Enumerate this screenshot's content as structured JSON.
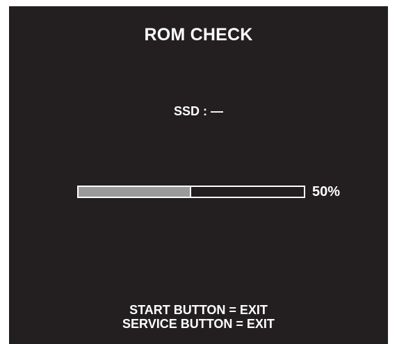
{
  "screen": {
    "title": "ROM CHECK",
    "ssd_status": "SSD : —",
    "progress": {
      "percent": 50,
      "label": "50%"
    },
    "footer": {
      "line1": "START BUTTON = EXIT",
      "line2": "SERVICE BUTTON = EXIT"
    },
    "colors": {
      "background": "#231f20",
      "text": "#ffffff",
      "progress_fill": "#9a9a9a"
    }
  }
}
